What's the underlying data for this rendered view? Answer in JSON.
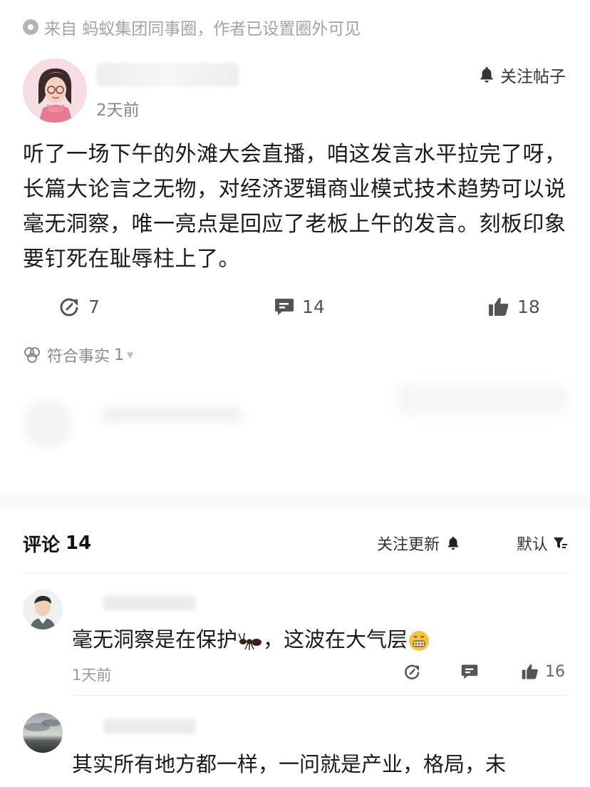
{
  "source": {
    "text": "来自 蚂蚁集团同事圈，作者已设置圈外可见"
  },
  "post": {
    "time": "2天前",
    "follow_label": "关注帖子",
    "body": "听了一场下午的外滩大会直播，咱这发言水平拉完了呀，长篇大论言之无物，对经济逻辑商业模式技术趋势可以说毫无洞察，唯一亮点是回应了老板上午的发言。刻板印象要钉死在耻辱柱上了。",
    "shares": "7",
    "comments": "14",
    "likes": "18",
    "fact_label": "符合事实",
    "fact_count": "1"
  },
  "comments_section": {
    "title": "评论",
    "count": "14",
    "follow_updates": "关注更新",
    "sort": "默认"
  },
  "comments": [
    {
      "text_before": "毫无洞察是在保护",
      "text_mid": "，这波在大气层",
      "time": "1天前",
      "likes": "16",
      "emoji_1": "ant-emoji",
      "emoji_2": "grin-emoji"
    },
    {
      "text": "其实所有地方都一样，一问就是产业，格局，未"
    }
  ],
  "colors": {
    "accent_gray": "#555555",
    "text": "#1a1a1a",
    "muted": "#9a9a9a"
  }
}
